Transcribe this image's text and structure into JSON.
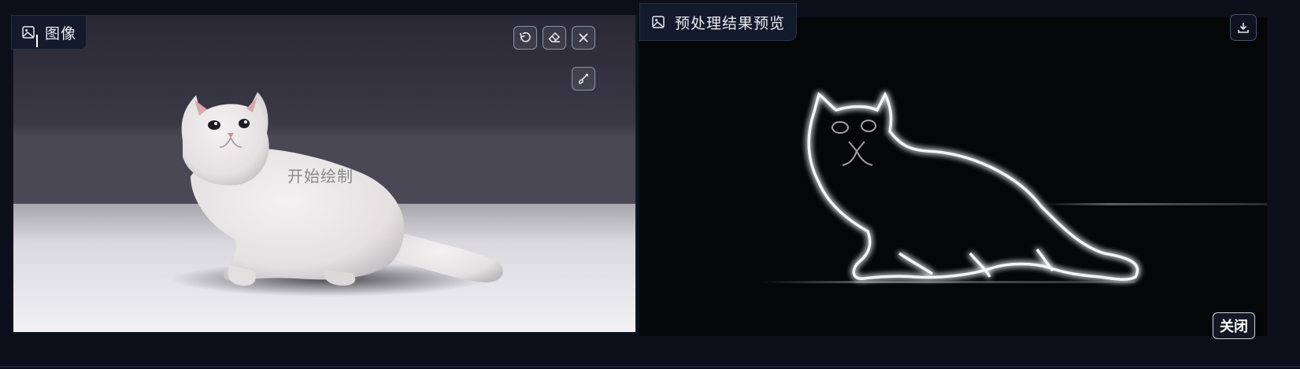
{
  "left_panel": {
    "tag_label": "图像",
    "tag_icon": "image-icon",
    "draw_hint": "开始绘制",
    "tools": [
      {
        "name": "undo-button",
        "icon": "undo-icon"
      },
      {
        "name": "eraser-button",
        "icon": "eraser-icon"
      },
      {
        "name": "clear-button",
        "icon": "close-icon"
      },
      {
        "name": "brush-button",
        "icon": "brush-icon"
      }
    ]
  },
  "right_panel": {
    "tag_label": "预处理结果预览",
    "tag_icon": "image-icon",
    "download_icon": "download-icon",
    "close_label": "关闭"
  },
  "colors": {
    "background": "#0b0f19",
    "tag_border": "#273049",
    "preview_background": "#050608"
  }
}
